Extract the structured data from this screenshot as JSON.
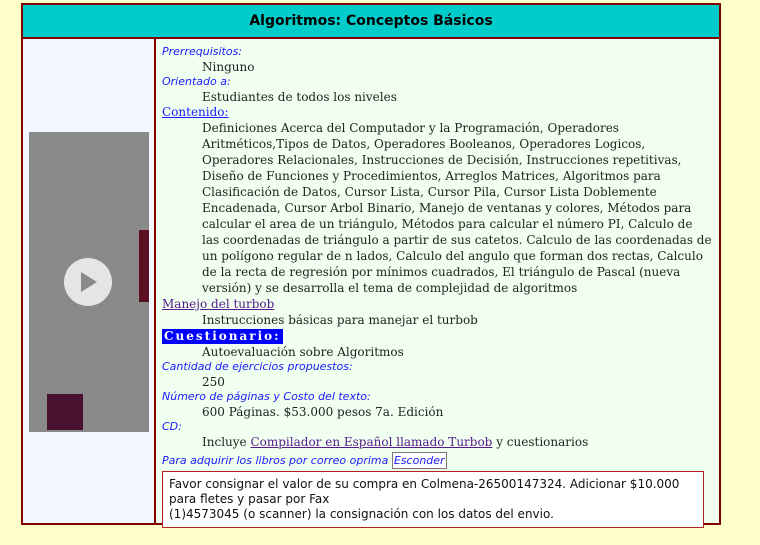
{
  "title": "Algoritmos: Conceptos Básicos",
  "sections": {
    "prerreq_label": "Prerrequisitos:",
    "prerreq_value": "Ninguno",
    "orientado_label": "Orientado a:",
    "orientado_value": "Estudiantes de todos los niveles",
    "contenido_label": "Contenido:",
    "contenido_value": "Definiciones Acerca del Computador y la Programación, Operadores Aritméticos,Tipos de Datos, Operadores Booleanos, Operadores Logicos, Operadores Relacionales, Instrucciones de Decisión, Instrucciones repetitivas, Diseño de Funciones y Procedimientos, Arreglos Matrices, Algoritmos para Clasificación de Datos, Cursor Lista, Cursor Pila, Cursor Lista Doblemente Encadenada, Cursor Arbol Binario, Manejo de ventanas y colores, Métodos para calcular el area de un triángulo, Métodos para calcular el número PI, Calculo de las coordenadas de triángulo a partir de sus catetos. Calculo de las coordenadas de un polígono regular de n lados, Calculo del angulo que forman dos rectas, Calculo de la recta de regresión por mínimos cuadrados, El triángulo de Pascal (nueva versión) y se desarrolla el tema de complejidad de algoritmos",
    "turbob_label": "Manejo del turbob",
    "turbob_value": "Instrucciones básicas para manejar el turbob",
    "cuestionario_label": "Cuestionario:",
    "cuestionario_value": "Autoevaluación sobre Algoritmos",
    "cantidad_label": "Cantidad de ejercicios propuestos:",
    "cantidad_value": "250",
    "paginas_label": "Número de páginas y Costo del texto:",
    "paginas_value": "600 Páginas. $53.000 pesos 7a. Edición",
    "cd_label": "CD:",
    "cd_prefix": "Incluye",
    "cd_link": "Compilador en Español llamado Turbob",
    "cd_suffix": "y cuestionarios"
  },
  "purchase": {
    "text": "Para adquirir los libros por correo oprima",
    "button": "Esconder",
    "note_line1": "Favor consignar el valor de su compra en Colmena-26500147324. Adicionar $10.000 para fletes y pasar por Fax",
    "note_line2": "(1)4573045 (o scanner) la consignación con los datos del envio."
  },
  "icons": {
    "play": "play-icon"
  },
  "colors": {
    "header_bg": "#00cccc",
    "border": "#800000",
    "page_bg": "#ffffcc",
    "content_bg": "#f0fff0"
  }
}
